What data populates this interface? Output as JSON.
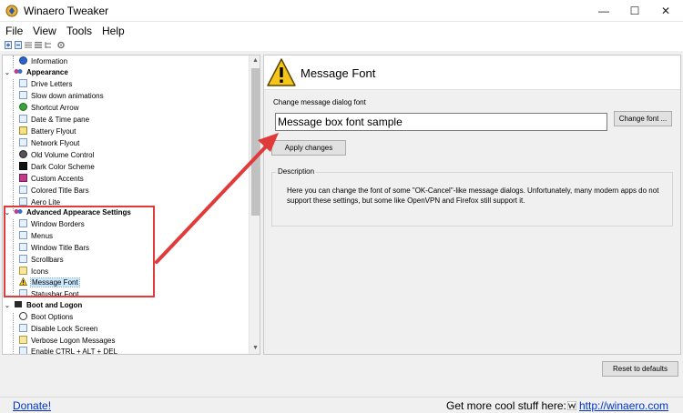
{
  "window": {
    "title": "Winaero Tweaker",
    "controls": {
      "minimize": "—",
      "maximize": "☐",
      "close": "✕"
    }
  },
  "menu": [
    "File",
    "View",
    "Tools",
    "Help"
  ],
  "tree": [
    {
      "label": "Information",
      "type": "item",
      "icon": "info-icon"
    },
    {
      "label": "Appearance",
      "type": "category",
      "icon": "appearance-icon"
    },
    {
      "label": "Drive Letters",
      "type": "item",
      "icon": "drive-icon"
    },
    {
      "label": "Slow down animations",
      "type": "item",
      "icon": "animation-icon"
    },
    {
      "label": "Shortcut Arrow",
      "type": "item",
      "icon": "shortcut-arrow-icon"
    },
    {
      "label": "Date & Time pane",
      "type": "item",
      "icon": "clock-icon"
    },
    {
      "label": "Battery Flyout",
      "type": "item",
      "icon": "battery-icon"
    },
    {
      "label": "Network Flyout",
      "type": "item",
      "icon": "network-icon"
    },
    {
      "label": "Old Volume Control",
      "type": "item",
      "icon": "volume-icon"
    },
    {
      "label": "Dark Color Scheme",
      "type": "item",
      "icon": "dark-scheme-icon"
    },
    {
      "label": "Custom Accents",
      "type": "item",
      "icon": "accent-icon"
    },
    {
      "label": "Colored Title Bars",
      "type": "item",
      "icon": "titlebar-color-icon"
    },
    {
      "label": "Aero Lite",
      "type": "item",
      "icon": "aero-icon"
    },
    {
      "label": "Advanced Appearace Settings",
      "type": "category",
      "icon": "advanced-appearance-icon"
    },
    {
      "label": "Window Borders",
      "type": "item",
      "icon": "window-border-icon"
    },
    {
      "label": "Menus",
      "type": "item",
      "icon": "menu-icon"
    },
    {
      "label": "Window Title Bars",
      "type": "item",
      "icon": "window-title-icon"
    },
    {
      "label": "Scrollbars",
      "type": "item",
      "icon": "scrollbar-icon"
    },
    {
      "label": "Icons",
      "type": "item",
      "icon": "icons-icon"
    },
    {
      "label": "Message Font",
      "type": "item",
      "icon": "warning-icon",
      "selected": true
    },
    {
      "label": "Statusbar Font",
      "type": "item",
      "icon": "font-icon"
    },
    {
      "label": "Boot and Logon",
      "type": "category",
      "icon": "boot-icon"
    },
    {
      "label": "Boot Options",
      "type": "item",
      "icon": "boot-options-icon"
    },
    {
      "label": "Disable Lock Screen",
      "type": "item",
      "icon": "lock-screen-icon"
    },
    {
      "label": "Verbose Logon Messages",
      "type": "item",
      "icon": "logon-icon"
    },
    {
      "label": "Enable CTRL + ALT + DEL",
      "type": "item",
      "icon": "keyboard-icon"
    }
  ],
  "panel": {
    "title": "Message Font",
    "change_label": "Change message dialog font",
    "sample_text": "Message box font sample",
    "change_button": "Change font ...",
    "apply_button": "Apply changes",
    "description_legend": "Description",
    "description_text": "Here you can change the font of some \"OK-Cancel\"-like message dialogs. Unfortunately, many modern apps do not support these settings, but some like OpenVPN and Firefox still support it."
  },
  "reset_button": "Reset to defaults",
  "footer": {
    "donate": "Donate!",
    "promo": "Get more cool stuff here:",
    "link": "http://winaero.com"
  },
  "colors": {
    "accent_red": "#e03a3a",
    "link_blue": "#0033cc",
    "selection": "#cce8ff"
  }
}
